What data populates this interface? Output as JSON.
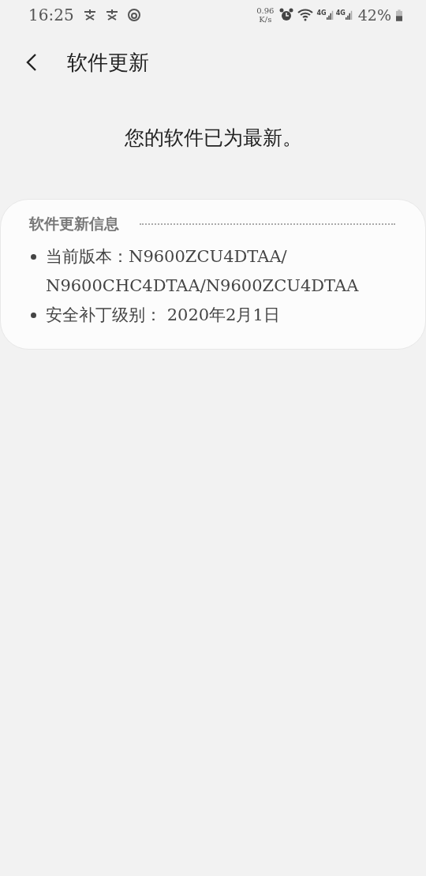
{
  "status_bar": {
    "time": "16:25",
    "net_speed": [
      "0.96",
      "K/s"
    ],
    "signal_labels": [
      "4G",
      "4G"
    ],
    "battery": "42%"
  },
  "header": {
    "title": "软件更新"
  },
  "message": "您的软件已为最新。",
  "info_card": {
    "title": "软件更新信息",
    "items": [
      {
        "label": "当前版本：",
        "value": "N9600ZCU4DTAA/\nN9600CHC4DTAA/N9600ZCU4DTAA"
      },
      {
        "label": "安全补丁级别：",
        "value": " 2020年2月1日"
      }
    ]
  }
}
